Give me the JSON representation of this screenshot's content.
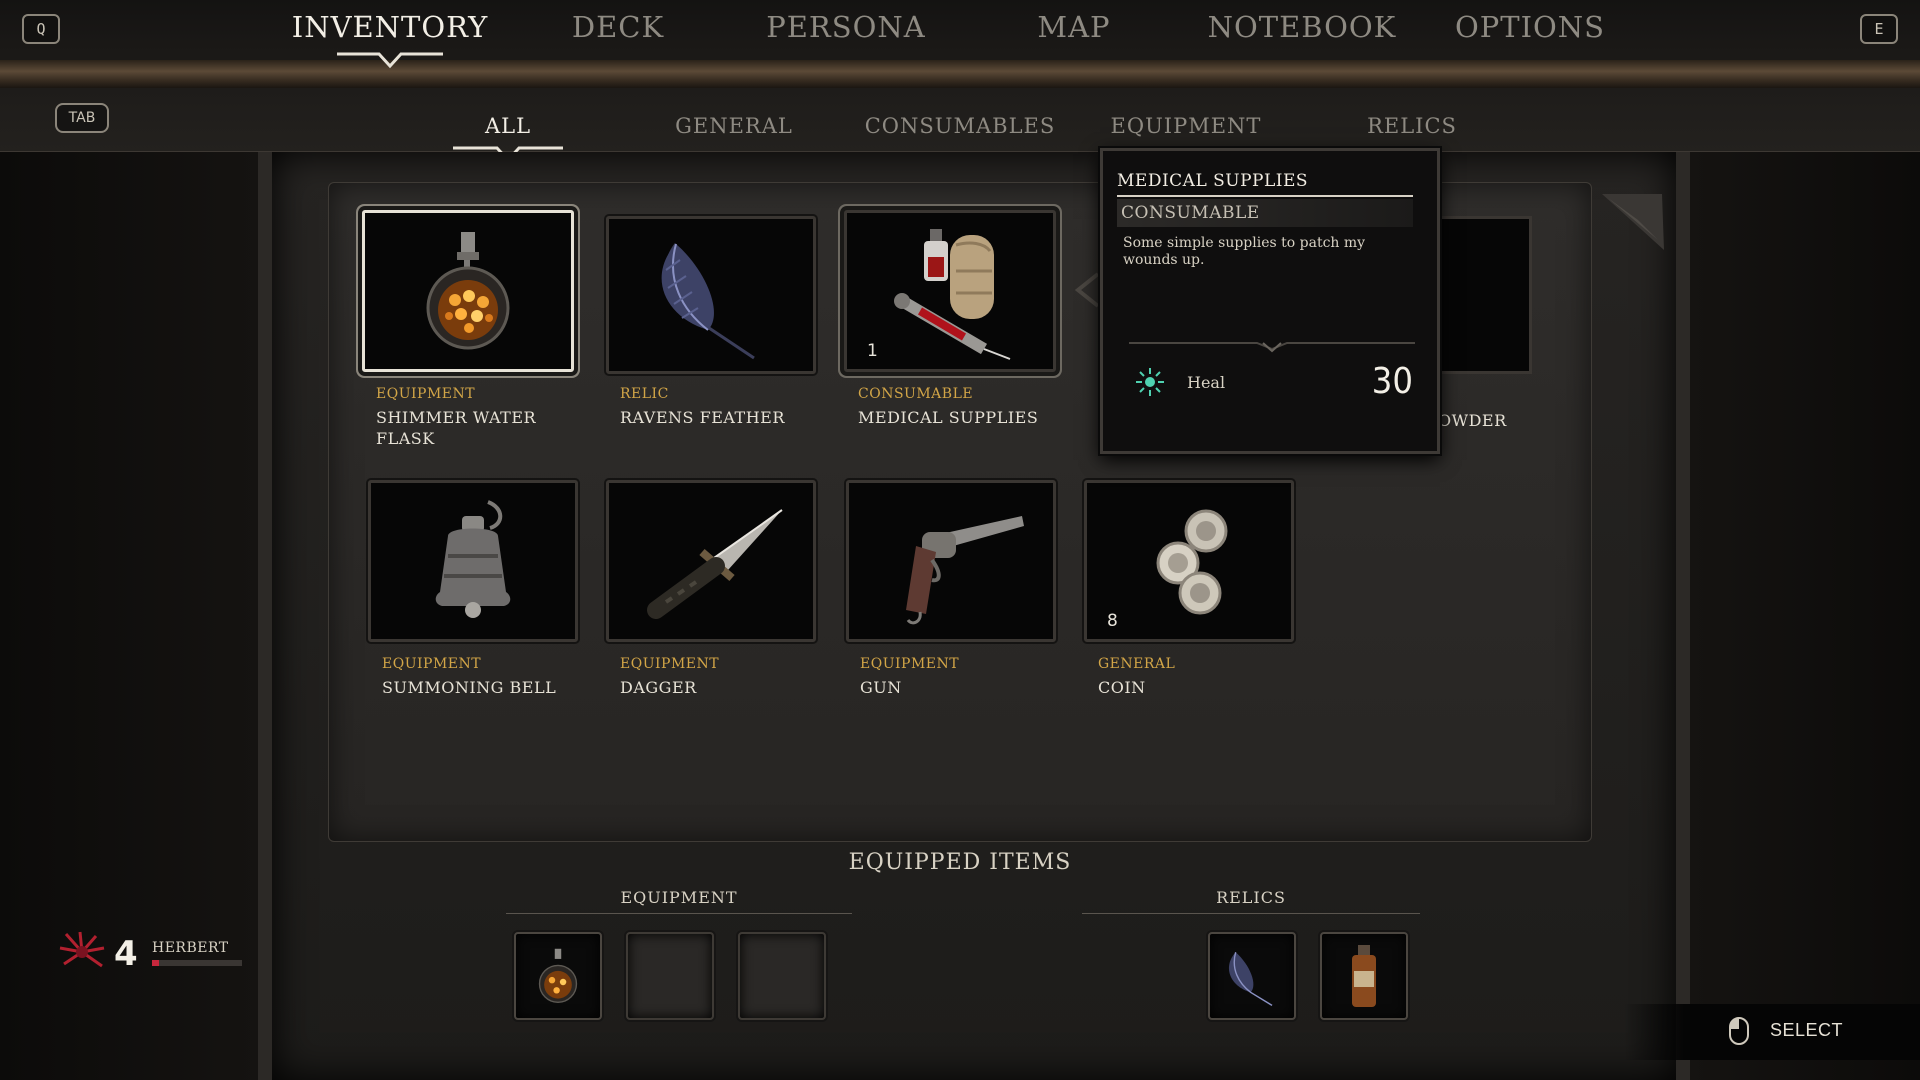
{
  "keys": {
    "left": "Q",
    "right": "E",
    "tab": "TAB"
  },
  "main_tabs": [
    {
      "label": "INVENTORY",
      "active": true
    },
    {
      "label": "DECK"
    },
    {
      "label": "PERSONA"
    },
    {
      "label": "MAP"
    },
    {
      "label": "NOTEBOOK"
    },
    {
      "label": "OPTIONS"
    }
  ],
  "sub_tabs": [
    {
      "label": "ALL",
      "active": true
    },
    {
      "label": "GENERAL"
    },
    {
      "label": "CONSUMABLES"
    },
    {
      "label": "EQUIPMENT"
    },
    {
      "label": "RELICS"
    }
  ],
  "items": [
    {
      "category": "EQUIPMENT",
      "name": "SHIMMER WATER FLASK",
      "icon": "flask-icon",
      "selected": true
    },
    {
      "category": "RELIC",
      "name": "RAVENS FEATHER",
      "icon": "feather-icon"
    },
    {
      "category": "CONSUMABLE",
      "name": "MEDICAL SUPPLIES",
      "icon": "medical-supplies-icon",
      "count": "1",
      "hovered": true
    },
    {
      "category": "EQUIPMENT",
      "name": "SUMMONING BELL",
      "icon": "bell-icon"
    },
    {
      "category": "EQUIPMENT",
      "name": "DAGGER",
      "icon": "dagger-icon"
    },
    {
      "category": "EQUIPMENT",
      "name": "GUN",
      "icon": "revolver-icon"
    },
    {
      "category": "GENERAL",
      "name": "COIN",
      "icon": "coins-icon",
      "count": "8"
    }
  ],
  "partial_item": {
    "name": "OWDER"
  },
  "tooltip": {
    "title": "MEDICAL SUPPLIES",
    "type": "CONSUMABLE",
    "description": "Some simple supplies to patch my wounds up.",
    "stat": {
      "label": "Heal",
      "value": "30",
      "icon": "heal-icon"
    }
  },
  "equipped": {
    "title": "EQUIPPED ITEMS",
    "equipment_heading": "EQUIPMENT",
    "relics_heading": "RELICS",
    "equipment_slots": [
      "flask-icon",
      "",
      ""
    ],
    "relic_slots": [
      "feather-icon",
      "bottle-icon"
    ]
  },
  "player": {
    "level": "4",
    "name": "HERBERT",
    "health_fraction": 0.08
  },
  "hint": {
    "label": "SELECT",
    "icon": "mouse-icon"
  },
  "colors": {
    "category": "#d2a547",
    "health": "#c7273c",
    "heal": "#4fd1b0"
  }
}
